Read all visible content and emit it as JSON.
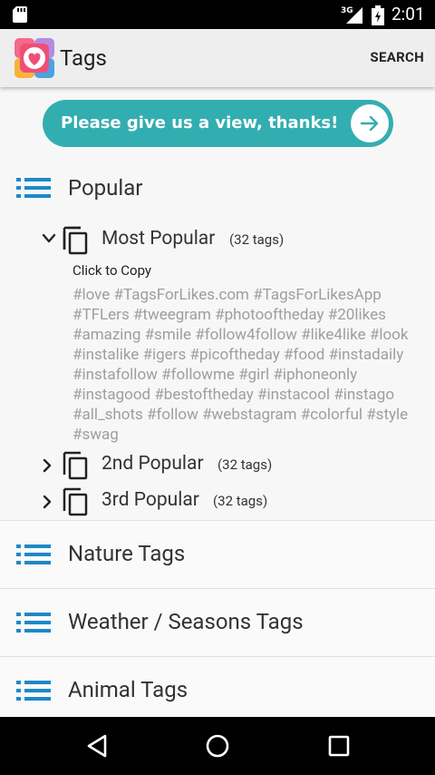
{
  "status_bar": {
    "time": "2:01",
    "network": "3G"
  },
  "app_bar": {
    "title": "Tags",
    "search_label": "SEARCH"
  },
  "banner": {
    "text": "Please give us a view, thanks!"
  },
  "popular": {
    "title": "Popular",
    "groups": [
      {
        "name": "Most Popular",
        "count": "(32 tags)",
        "expanded": true
      },
      {
        "name": "2nd Popular",
        "count": "(32 tags)",
        "expanded": false
      },
      {
        "name": "3rd Popular",
        "count": "(32 tags)",
        "expanded": false
      }
    ],
    "click_to_copy": "Click to Copy",
    "tags_text": "#love #TagsForLikes.com #TagsForLikesApp #TFLers #tweegram #photooftheday #20likes #amazing #smile #follow4follow #like4like #look #instalike #igers #picoftheday #food #instadaily #instafollow #followme #girl #iphoneonly #instagood #bestoftheday #instacool #instago #all_shots #follow #webstagram #colorful #style #swag"
  },
  "categories": [
    {
      "title": "Nature Tags"
    },
    {
      "title": "Weather / Seasons Tags"
    },
    {
      "title": "Animal Tags"
    }
  ],
  "colors": {
    "accent": "#33aeb0",
    "list_icon": "#1e88c8"
  }
}
